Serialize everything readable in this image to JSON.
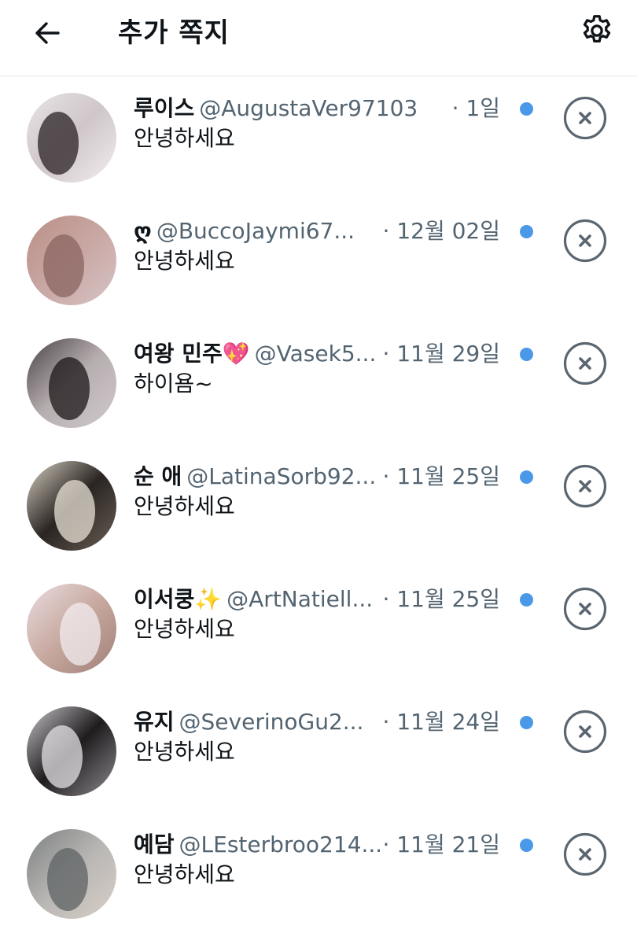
{
  "header": {
    "title": "추가 쪽지",
    "back_icon": "arrow-left-icon",
    "settings_icon": "gear-icon"
  },
  "colors": {
    "unread_dot": "#4a99e9",
    "muted_text": "#536471",
    "icon_gray": "#5b6670"
  },
  "requests": [
    {
      "name": "루이스",
      "handle": "@AugustaVer97103",
      "date": "· 1일",
      "message": "안녕하세요",
      "avatar_colors": [
        "#e8e4e6",
        "#cfc6c9",
        "#2a2224",
        "#f2eef0"
      ],
      "unread": true
    },
    {
      "name": "ღ",
      "handle": "@BuccoJaymi67...",
      "date": "· 12월 02일",
      "message": "안녕하세요",
      "avatar_colors": [
        "#b98f86",
        "#c9a7a3",
        "#8a6460",
        "#d6c3c6"
      ],
      "unread": true
    },
    {
      "name": "여왕 민주💖",
      "handle": "@Vasek5...",
      "date": "· 11월 29일",
      "message": "하이욤~",
      "avatar_colors": [
        "#4a4446",
        "#b7aeb0",
        "#1c1718",
        "#d0c9cb"
      ],
      "unread": true
    },
    {
      "name": "순 애",
      "handle": "@LatinaSorb92...",
      "date": "· 11월 25일",
      "message": "안녕하세요",
      "avatar_colors": [
        "#d8cfc3",
        "#2a2522",
        "#e8e1d5",
        "#6a5e55"
      ],
      "unread": true
    },
    {
      "name": "이서쿵✨",
      "handle": "@ArtNatiell...",
      "date": "· 11월 25일",
      "message": "안녕하세요",
      "avatar_colors": [
        "#e9dde2",
        "#c8a99f",
        "#f3ecf0",
        "#9f7f78"
      ],
      "unread": true
    },
    {
      "name": "유지",
      "handle": "@SeverinoGu2...",
      "date": "· 11월 24일",
      "message": "안녕하세요",
      "avatar_colors": [
        "#c9c7cb",
        "#1f1c1e",
        "#e4e2e6",
        "#8e8a90"
      ],
      "unread": true
    },
    {
      "name": "예담",
      "handle": "@LEsterbroo214...",
      "date": "· 11월 21일",
      "message": "안녕하세요",
      "avatar_colors": [
        "#7c8080",
        "#b8b6b4",
        "#5d6163",
        "#d9cfc7"
      ],
      "unread": true
    }
  ]
}
